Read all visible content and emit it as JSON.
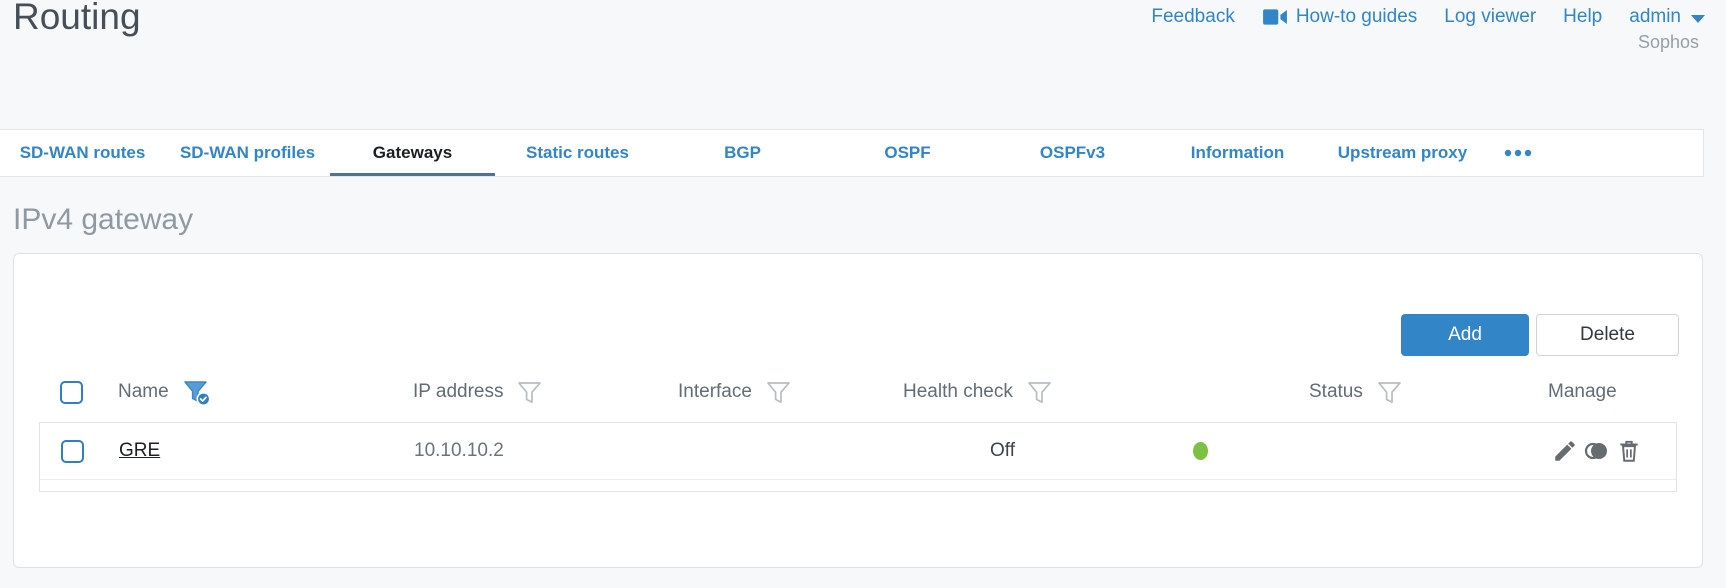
{
  "page": {
    "title": "Routing",
    "brand": "Sophos"
  },
  "top_nav": {
    "feedback": "Feedback",
    "howto_guides": "How-to guides",
    "log_viewer": "Log viewer",
    "help": "Help",
    "user": "admin"
  },
  "tabs": {
    "items": [
      {
        "label": "SD-WAN routes"
      },
      {
        "label": "SD-WAN profiles"
      },
      {
        "label": "Gateways"
      },
      {
        "label": "Static routes"
      },
      {
        "label": "BGP"
      },
      {
        "label": "OSPF"
      },
      {
        "label": "OSPFv3"
      },
      {
        "label": "Information"
      },
      {
        "label": "Upstream proxy"
      }
    ],
    "active_index": 2
  },
  "section": {
    "heading": "IPv4 gateway"
  },
  "toolbar": {
    "add_label": "Add",
    "delete_label": "Delete"
  },
  "table": {
    "columns": [
      {
        "label": "Name",
        "filter": "active"
      },
      {
        "label": "IP address",
        "filter": "default"
      },
      {
        "label": "Interface",
        "filter": "default"
      },
      {
        "label": "Health check",
        "filter": "default"
      },
      {
        "label": "Status",
        "filter": "default"
      },
      {
        "label": "Manage",
        "filter": "none"
      }
    ],
    "rows": [
      {
        "name": "GRE",
        "ip_address": "10.10.10.2",
        "interface": "",
        "health_check": "Off",
        "status": "up"
      }
    ]
  },
  "colors": {
    "accent": "#3285c7",
    "status_up": "#7cc142",
    "active_tab_underline": "#4f7396"
  }
}
